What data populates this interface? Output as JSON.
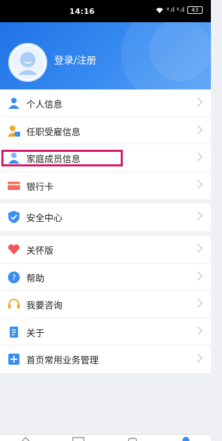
{
  "status_bar": {
    "time": "14:16",
    "signal_text": "ᵍ.ıl ᵍ.ıl",
    "battery": "43"
  },
  "header": {
    "login_label": "登录/注册"
  },
  "groups": [
    {
      "items": [
        {
          "label": "个人信息",
          "icon": "person-icon"
        },
        {
          "label": "任职受雇信息",
          "icon": "employee-badge-icon"
        },
        {
          "label": "家庭成员信息",
          "icon": "family-members-icon"
        },
        {
          "label": "银行卡",
          "icon": "bank-card-icon"
        }
      ]
    },
    {
      "items": [
        {
          "label": "安全中心",
          "icon": "shield-icon"
        }
      ]
    },
    {
      "items": [
        {
          "label": "关怀版",
          "icon": "heart-icon"
        },
        {
          "label": "帮助",
          "icon": "help-icon"
        },
        {
          "label": "我要咨询",
          "icon": "headset-icon"
        },
        {
          "label": "关于",
          "icon": "document-icon"
        },
        {
          "label": "首页常用业务管理",
          "icon": "grid-manage-icon"
        }
      ]
    }
  ],
  "colors": {
    "header": "#2a7fef",
    "highlight": "#d4176a",
    "accent": "#3a8ef0"
  }
}
